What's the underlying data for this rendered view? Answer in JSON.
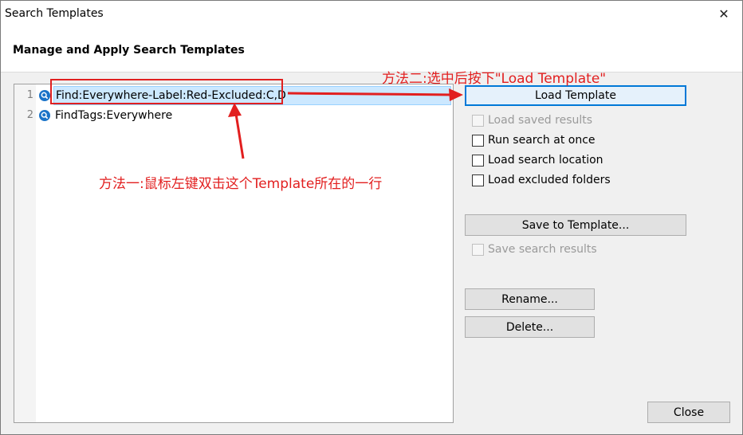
{
  "window": {
    "title": "Search Templates",
    "close_glyph": "✕",
    "header": "Manage and Apply Search Templates"
  },
  "templates": [
    {
      "num": "1",
      "label": "Find:Everywhere-Label:Red-Excluded:C,D",
      "icon": "search-icon"
    },
    {
      "num": "2",
      "label": "FindTags:Everywhere",
      "icon": "search-icon"
    }
  ],
  "buttons": {
    "load_template": "Load Template",
    "save_to_template": "Save to Template...",
    "rename": "Rename...",
    "delete": "Delete...",
    "close": "Close"
  },
  "options": {
    "load_saved_results": "Load saved results",
    "run_search_at_once": "Run search at once",
    "load_search_location": "Load search location",
    "load_excluded_folders": "Load excluded folders",
    "save_search_results": "Save search results"
  },
  "annotations": {
    "method2": "方法二:选中后按下\"Load Template\"",
    "method1": "方法一:鼠标左键双击这个Template所在的一行"
  },
  "colors": {
    "selection": "#cce8ff",
    "focus_border": "#0078d7",
    "annotation_red": "#e21f1f",
    "search_icon": "#1a73c8"
  }
}
